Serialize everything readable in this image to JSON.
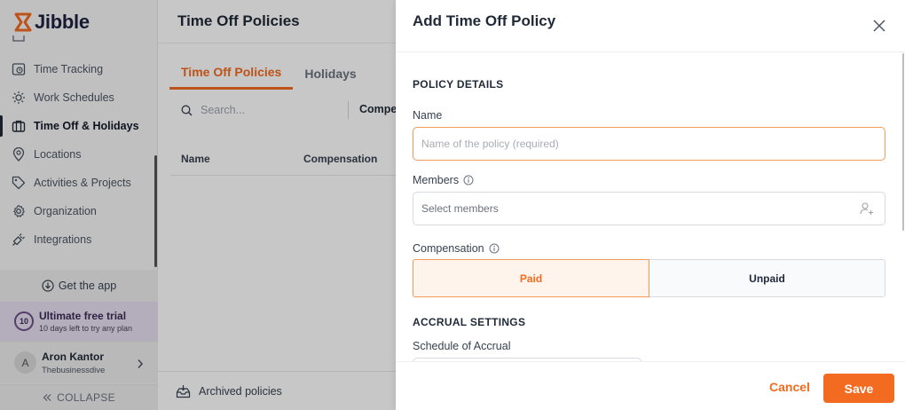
{
  "app": {
    "logo_text": "Jibble"
  },
  "sidebar": {
    "items": [
      {
        "label": "Time Tracking",
        "icon": "time-tracking-icon",
        "active": false
      },
      {
        "label": "Work Schedules",
        "icon": "work-schedules-icon",
        "active": false
      },
      {
        "label": "Time Off & Holidays",
        "icon": "time-off-icon",
        "active": true
      },
      {
        "label": "Locations",
        "icon": "location-pin-icon",
        "active": false
      },
      {
        "label": "Activities & Projects",
        "icon": "tag-icon",
        "active": false
      },
      {
        "label": "Organization",
        "icon": "gear-icon",
        "active": false
      },
      {
        "label": "Integrations",
        "icon": "plug-icon",
        "active": false
      }
    ],
    "get_app": "Get the app",
    "trial": {
      "badge": "10",
      "title": "Ultimate free trial",
      "subtitle": "10 days left to try any plan"
    },
    "user": {
      "initial": "A",
      "name": "Aron Kantor",
      "org": "Thebusinessdive"
    },
    "collapse": "COLLAPSE"
  },
  "main": {
    "title": "Time Off Policies",
    "tabs": [
      {
        "label": "Time Off Policies",
        "active": true
      },
      {
        "label": "Holidays",
        "active": false
      }
    ],
    "search_placeholder": "Search...",
    "filter_label": "Compen",
    "table_headers": {
      "name": "Name",
      "compensation": "Compensation"
    },
    "archived": "Archived policies"
  },
  "drawer": {
    "title": "Add Time Off Policy",
    "policy_details": "POLICY DETAILS",
    "name_label": "Name",
    "name_placeholder": "Name of the policy (required)",
    "name_value": "",
    "members_label": "Members",
    "members_placeholder": "Select members",
    "compensation_label": "Compensation",
    "compensation_options": [
      {
        "label": "Paid",
        "selected": true
      },
      {
        "label": "Unpaid",
        "selected": false
      }
    ],
    "accrual_settings": "ACCRUAL SETTINGS",
    "schedule_label": "Schedule of Accrual",
    "cancel": "Cancel",
    "save": "Save"
  },
  "colors": {
    "accent": "#f26b21",
    "accent_light": "#fff4ec",
    "navy": "#1e2340",
    "trial_bg": "#e7def0"
  }
}
